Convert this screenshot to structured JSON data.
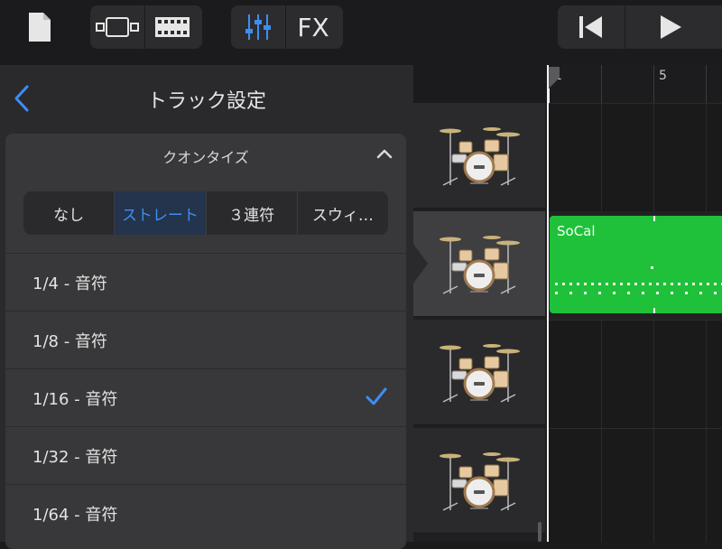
{
  "toolbar": {
    "fx_label": "FX"
  },
  "panel": {
    "title": "トラック設定",
    "quantize": {
      "title": "クオンタイズ",
      "segments": [
        "なし",
        "ストレート",
        "３連符",
        "スウィ…"
      ],
      "selected_segment": "ストレート",
      "options": [
        "1/4 - 音符",
        "1/8 - 音符",
        "1/16 - 音符",
        "1/32 - 音符",
        "1/64 - 音符"
      ],
      "selected_option": "1/16 - 音符"
    }
  },
  "ruler": {
    "bars": [
      "1",
      "5"
    ]
  },
  "region": {
    "name": "SoCal",
    "color": "#1fc13a"
  },
  "colors": {
    "accent": "#3d8df5",
    "background": "#1b1b1d",
    "panel": "#2a2a2c"
  }
}
